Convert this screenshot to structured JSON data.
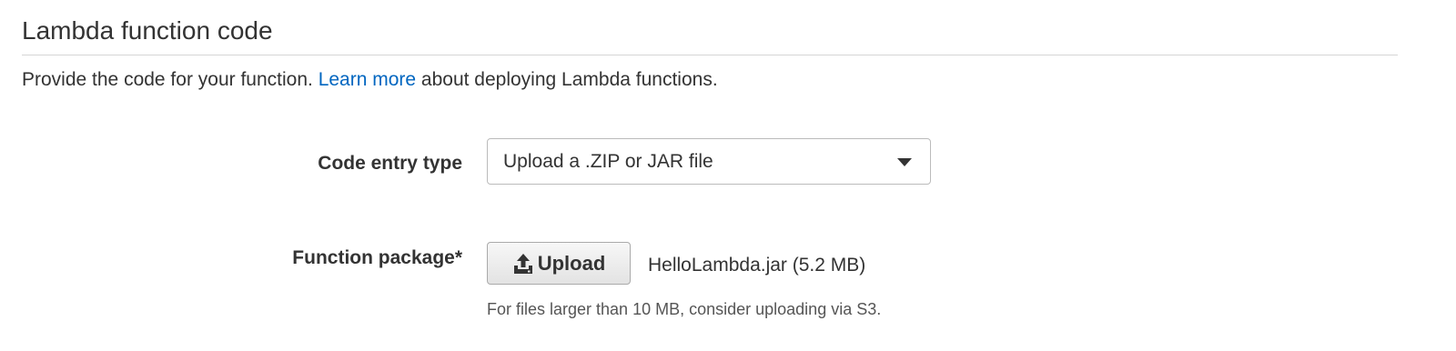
{
  "section": {
    "title": "Lambda function code",
    "description_before": "Provide the code for your function. ",
    "learn_more_link": "Learn more",
    "description_after": " about deploying Lambda functions."
  },
  "code_entry": {
    "label": "Code entry type",
    "selected_value": "Upload a .ZIP or JAR file"
  },
  "function_package": {
    "label": "Function package*",
    "upload_button_label": "Upload",
    "file_name": "HelloLambda.jar (5.2 MB)",
    "help_text": "For files larger than 10 MB, consider uploading via S3."
  },
  "colors": {
    "link": "#0066c0",
    "text": "#333333",
    "border": "#bbbbbb"
  },
  "icons": {
    "upload": "upload-icon",
    "dropdown": "caret-down-icon"
  }
}
